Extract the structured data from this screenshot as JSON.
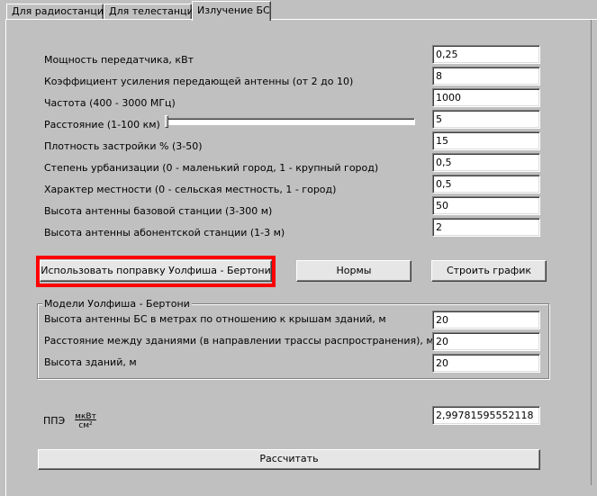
{
  "tabs": [
    {
      "label": "Для радиостанции",
      "active": false
    },
    {
      "label": "Для телестанции",
      "active": false
    },
    {
      "label": "Излучение БС",
      "active": true
    }
  ],
  "params": [
    {
      "label": "Мощность передатчика, кВт",
      "value": "0,25"
    },
    {
      "label": "Коэффициент усиления передающей антенны (от 2 до 10)",
      "value": "8"
    },
    {
      "label": "Частота (400 - 3000 МГц)",
      "value": "1000"
    },
    {
      "label": "Расстояние (1-100 км)",
      "value": "5"
    },
    {
      "label": "Плотность застройки %  (3-50)",
      "value": "15"
    },
    {
      "label": "Степень урбанизации (0 - маленький город, 1 - крупный город)",
      "value": "0,5"
    },
    {
      "label": "Характер местности (0 - сельская местность, 1 - город)",
      "value": "0,5"
    },
    {
      "label": "Высота антенны базовой станции (3-300 м)",
      "value": "50"
    },
    {
      "label": "Высота антенны абонентской станции (1-3 м)",
      "value": "2"
    }
  ],
  "distance_slider": {
    "value_fraction": 0.0
  },
  "buttons": {
    "walfisch": "Использовать поправку Уолфиша - Бертони",
    "norms": "Нормы",
    "plot": "Строить график",
    "calculate": "Рассчитать"
  },
  "walfisch_group": {
    "title": "Модели Уолфиша - Бертони",
    "fields": [
      {
        "label": "Высота антенны БС в метрах по отношению к крышам зданий, м",
        "value": "20"
      },
      {
        "label": "Расстояние между зданиями (в направлении трассы распространения), м",
        "value": "20"
      },
      {
        "label": "Высота зданий, м",
        "value": "20"
      }
    ]
  },
  "result": {
    "label": "ППЭ",
    "unit_numerator": "мкВт",
    "unit_denominator": "см²",
    "value": "2,99781595552118"
  },
  "colors": {
    "highlight": "#ff0000",
    "window": "#c0c0c0"
  }
}
